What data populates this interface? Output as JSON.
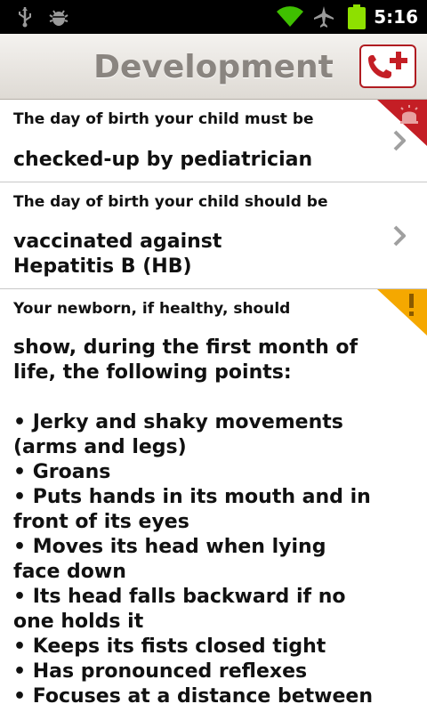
{
  "status_bar": {
    "time": "5:16",
    "icons": [
      "usb-icon",
      "debug-icon",
      "wifi-icon",
      "airplane-icon",
      "battery-icon"
    ]
  },
  "header": {
    "title": "Development",
    "call_icon": "phone-plus-icon"
  },
  "colors": {
    "danger": "#c41e25",
    "warning": "#f5a800",
    "title_text": "#8a8580"
  },
  "items": [
    {
      "subtitle": "The day of birth your child must be",
      "text": "checked-up by pediatrician",
      "badge": "alarm-icon"
    },
    {
      "subtitle": "The day of birth your child  should be",
      "text": "vaccinated against\nHepatitis B (HB)",
      "badge": ""
    },
    {
      "subtitle": "Your newborn, if healthy, should",
      "text": "show, during the first month of life, the following points:\n\n• Jerky and shaky movements (arms and legs)\n• Groans\n• Puts hands in its mouth and in front of its eyes\n• Moves its head when lying face down\n• Its head falls backward if no one holds it\n• Keeps its fists closed tight\n• Has pronounced reflexes\n• Focuses at a distance between",
      "badge": "exclamation-icon"
    }
  ]
}
